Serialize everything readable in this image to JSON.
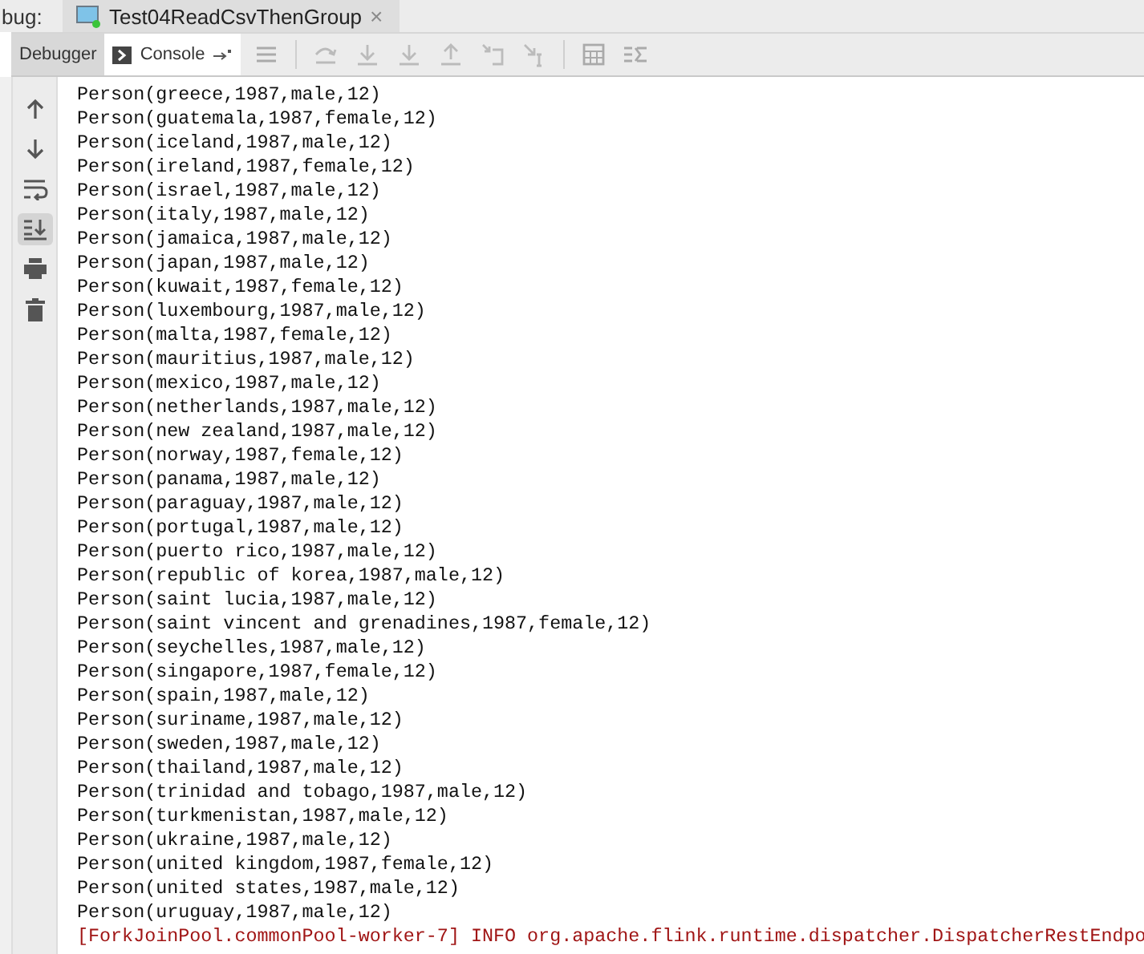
{
  "header": {
    "label": "bug:",
    "run_tab": {
      "title": "Test04ReadCsvThenGroup",
      "close": "×"
    }
  },
  "tabs": [
    {
      "label": "Debugger",
      "selected": false
    },
    {
      "label": "Console",
      "selected": true
    }
  ],
  "console_lines": [
    {
      "kind": "out",
      "text": "Person(greece,1987,male,12)"
    },
    {
      "kind": "out",
      "text": "Person(guatemala,1987,female,12)"
    },
    {
      "kind": "out",
      "text": "Person(iceland,1987,male,12)"
    },
    {
      "kind": "out",
      "text": "Person(ireland,1987,female,12)"
    },
    {
      "kind": "out",
      "text": "Person(israel,1987,male,12)"
    },
    {
      "kind": "out",
      "text": "Person(italy,1987,male,12)"
    },
    {
      "kind": "out",
      "text": "Person(jamaica,1987,male,12)"
    },
    {
      "kind": "out",
      "text": "Person(japan,1987,male,12)"
    },
    {
      "kind": "out",
      "text": "Person(kuwait,1987,female,12)"
    },
    {
      "kind": "out",
      "text": "Person(luxembourg,1987,male,12)"
    },
    {
      "kind": "out",
      "text": "Person(malta,1987,female,12)"
    },
    {
      "kind": "out",
      "text": "Person(mauritius,1987,male,12)"
    },
    {
      "kind": "out",
      "text": "Person(mexico,1987,male,12)"
    },
    {
      "kind": "out",
      "text": "Person(netherlands,1987,male,12)"
    },
    {
      "kind": "out",
      "text": "Person(new zealand,1987,male,12)"
    },
    {
      "kind": "out",
      "text": "Person(norway,1987,female,12)"
    },
    {
      "kind": "out",
      "text": "Person(panama,1987,male,12)"
    },
    {
      "kind": "out",
      "text": "Person(paraguay,1987,male,12)"
    },
    {
      "kind": "out",
      "text": "Person(portugal,1987,male,12)"
    },
    {
      "kind": "out",
      "text": "Person(puerto rico,1987,male,12)"
    },
    {
      "kind": "out",
      "text": "Person(republic of korea,1987,male,12)"
    },
    {
      "kind": "out",
      "text": "Person(saint lucia,1987,male,12)"
    },
    {
      "kind": "out",
      "text": "Person(saint vincent and grenadines,1987,female,12)"
    },
    {
      "kind": "out",
      "text": "Person(seychelles,1987,male,12)"
    },
    {
      "kind": "out",
      "text": "Person(singapore,1987,female,12)"
    },
    {
      "kind": "out",
      "text": "Person(spain,1987,male,12)"
    },
    {
      "kind": "out",
      "text": "Person(suriname,1987,male,12)"
    },
    {
      "kind": "out",
      "text": "Person(sweden,1987,male,12)"
    },
    {
      "kind": "out",
      "text": "Person(thailand,1987,male,12)"
    },
    {
      "kind": "out",
      "text": "Person(trinidad and tobago,1987,male,12)"
    },
    {
      "kind": "out",
      "text": "Person(turkmenistan,1987,male,12)"
    },
    {
      "kind": "out",
      "text": "Person(ukraine,1987,male,12)"
    },
    {
      "kind": "out",
      "text": "Person(united kingdom,1987,female,12)"
    },
    {
      "kind": "out",
      "text": "Person(united states,1987,male,12)"
    },
    {
      "kind": "out",
      "text": "Person(uruguay,1987,male,12)"
    },
    {
      "kind": "err",
      "text": "[ForkJoinPool.commonPool-worker-7] INFO org.apache.flink.runtime.dispatcher.DispatcherRestEndpo"
    }
  ]
}
